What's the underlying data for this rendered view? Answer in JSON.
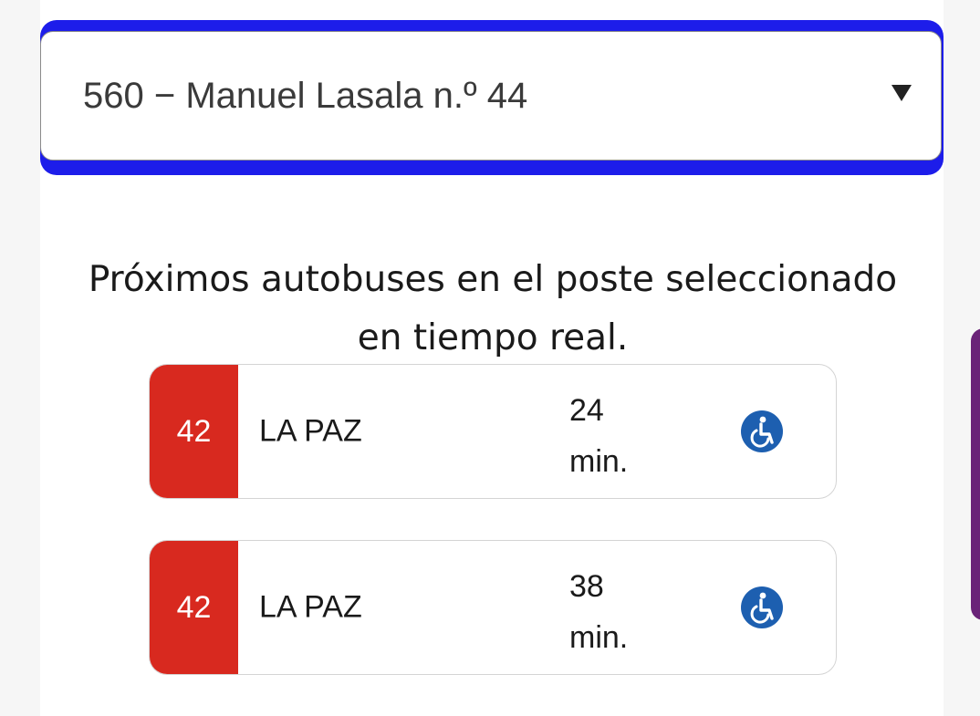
{
  "stop_select": {
    "value": "560 − Manuel Lasala n.º 44",
    "arrow_icon": "triangle-down-icon"
  },
  "heading": {
    "line1": "Próximos autobuses en el poste seleccionado",
    "line2": "en tiempo real."
  },
  "buses": [
    {
      "line": "42",
      "destination": "LA PAZ",
      "eta_value": "24",
      "eta_unit": "min.",
      "accessible_icon": "wheelchair-icon"
    },
    {
      "line": "42",
      "destination": "LA PAZ",
      "eta_value": "38",
      "eta_unit": "min.",
      "accessible_icon": "wheelchair-icon"
    }
  ],
  "colors": {
    "focus_ring": "#1d1dea",
    "line_badge": "#d8291f",
    "accessible_icon": "#1d5fb0",
    "side_tab": "#6a2378"
  }
}
